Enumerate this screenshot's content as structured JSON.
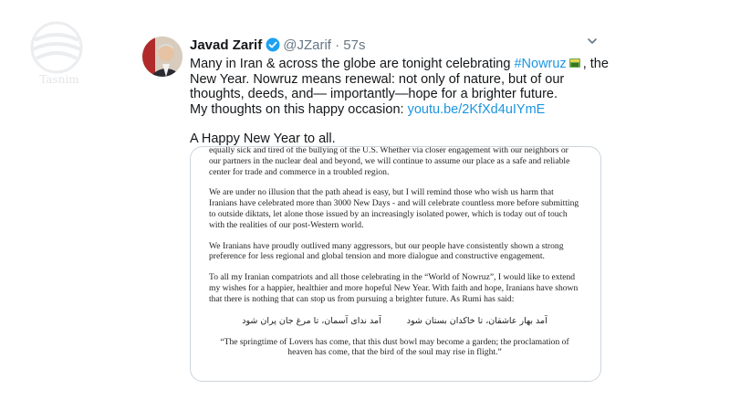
{
  "watermark": {
    "text": "Tasnim"
  },
  "tweet": {
    "display_name": "Javad Zarif",
    "handle": "@JZarif",
    "separator": "·",
    "time": "57s",
    "line1_pre": "Many in Iran & across the globe are tonight celebrating ",
    "hashtag": "#Nowruz",
    "line1_post": ", the New Year. Nowruz means renewal: not only of nature, but of our thoughts, deeds, and— importantly—hope for a brighter future.",
    "line2_pre": "My thoughts on this happy occasion: ",
    "link": "youtu.be/2KfXd4uIYmE",
    "line3": "A Happy New Year to all."
  },
  "document": {
    "p1": "equally sick and tired of the bullying of the U.S. Whether via closer engagement with our neighbors or our partners in the nuclear deal and beyond, we will continue to assume our place as a safe and reliable center for trade and commerce in a troubled region.",
    "p2": "We are under no illusion that the path ahead is easy, but I will remind those who wish us harm that Iranians have celebrated more than 3000 New Days - and will celebrate countless more before submitting to outside diktats, let alone those issued by an increasingly isolated power, which is today out of touch with the realities of our post-Western world.",
    "p3": "We Iranians have proudly outlived many aggressors, but our people have consistently shown a strong preference for less regional and global tension and more dialogue and constructive engagement.",
    "p4": "To all my Iranian compatriots and all those celebrating in the “World of Nowruz”, I would like to extend my wishes for a happier, healthier and more hopeful New Year. With faith and hope, Iranians have shown that there is nothing that can stop us from pursuing a brighter future. As Rumi has said:",
    "farsi_line1": "آمد بهار عاشقان، تا خاکدان بستان شود",
    "farsi_line2": "آمد ندای آسمان، تا مرغ جان پران شود",
    "quote": "“The springtime of Lovers has come, that this dust bowl may become a garden; the proclamation of heaven has come, that the bird of the soul may rise in flight.”"
  }
}
